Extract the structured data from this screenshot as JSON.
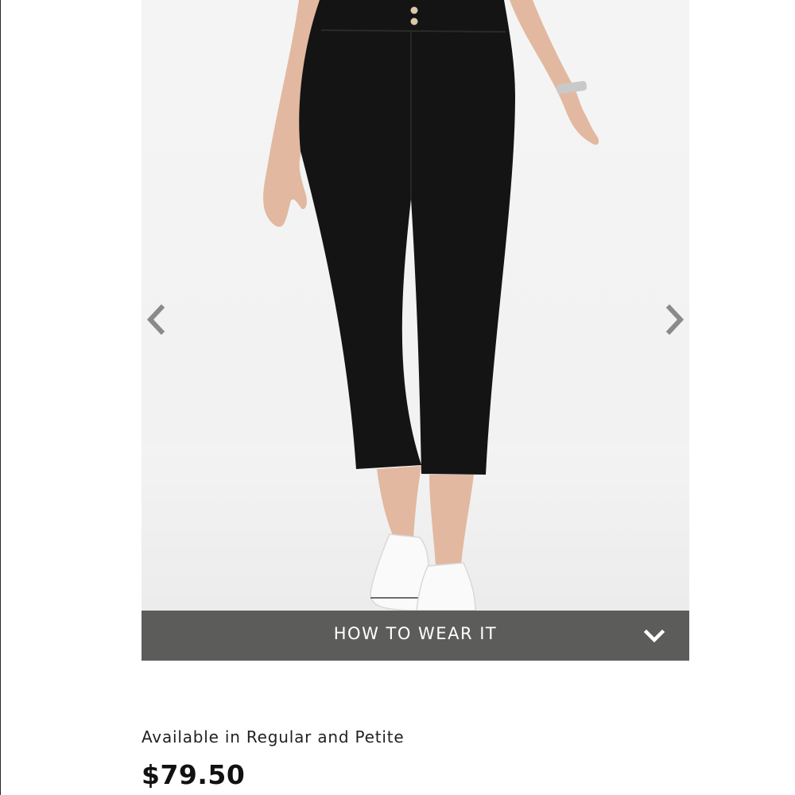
{
  "product": {
    "gallery": {
      "image_subject": "product-photo-black-cropped-pants",
      "prev_icon": "chevron-left-icon",
      "next_icon": "chevron-right-icon"
    },
    "how_to_wear": {
      "label": "HOW TO WEAR IT",
      "icon": "chevron-down-icon"
    },
    "availability": "Available in Regular and Petite",
    "price": "$79.50"
  },
  "colors": {
    "bar_background": "#5c5d5b",
    "bar_text": "#ffffff",
    "arrow": "#8a8a8a",
    "pants": "#141414"
  }
}
